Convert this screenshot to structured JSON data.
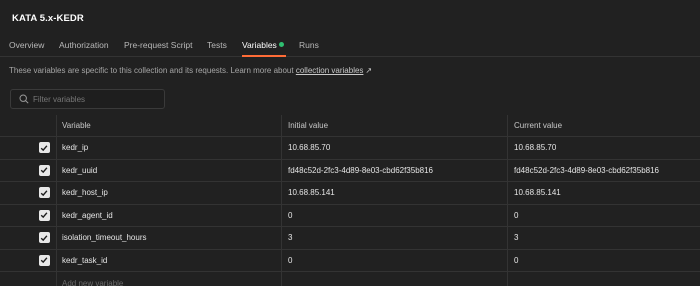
{
  "app": {
    "title": "KATA 5.x-KEDR"
  },
  "tabs": [
    {
      "label": "Overview"
    },
    {
      "label": "Authorization"
    },
    {
      "label": "Pre-request Script"
    },
    {
      "label": "Tests"
    },
    {
      "label": "Variables",
      "active": true
    },
    {
      "label": "Runs"
    }
  ],
  "description": {
    "text": "These variables are specific to this collection and its requests. Learn more about ",
    "link": "collection variables",
    "arrow": "↗"
  },
  "filter": {
    "placeholder": "Filter variables",
    "value": ""
  },
  "table": {
    "columns": [
      "Variable",
      "Initial value",
      "Current value"
    ],
    "rows": [
      {
        "checked": true,
        "variable": "kedr_ip",
        "initial": "10.68.85.70",
        "current": "10.68.85.70"
      },
      {
        "checked": true,
        "variable": "kedr_uuid",
        "initial": "fd48c52d-2fc3-4d89-8e03-cbd62f35b816",
        "current": "fd48c52d-2fc3-4d89-8e03-cbd62f35b816"
      },
      {
        "checked": true,
        "variable": "kedr_host_ip",
        "initial": "10.68.85.141",
        "current": "10.68.85.141"
      },
      {
        "checked": true,
        "variable": "kedr_agent_id",
        "initial": "0",
        "current": "0"
      },
      {
        "checked": true,
        "variable": "isolation_timeout_hours",
        "initial": "3",
        "current": "3"
      },
      {
        "checked": true,
        "variable": "kedr_task_id",
        "initial": "0",
        "current": "0"
      }
    ],
    "add_placeholder": "Add new variable"
  },
  "colors": {
    "accent": "#ff6c37",
    "status_dot": "#2fbf71",
    "background": "#212121"
  }
}
